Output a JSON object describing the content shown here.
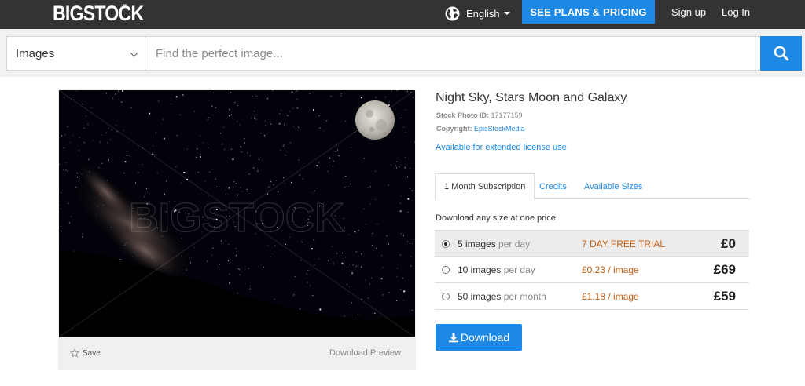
{
  "header": {
    "logo": "BIGSTOCK",
    "logo_tm": "™",
    "language": "English",
    "plans_button": "SEE PLANS & PRICING",
    "signup": "Sign up",
    "login": "Log In"
  },
  "search": {
    "category": "Images",
    "placeholder": "Find the perfect image..."
  },
  "image": {
    "watermark": "BIGSTOCK",
    "save_label": "Save",
    "preview_label": "Download Preview"
  },
  "details": {
    "title": "Night Sky, Stars Moon and Galaxy",
    "stock_id_label": "Stock Photo ID:",
    "stock_id": "17177159",
    "copyright_label": "Copyright:",
    "copyright": "EpicStockMedia",
    "extended_license": "Available for extended license use"
  },
  "tabs": [
    {
      "label": "1 Month Subscription",
      "active": true
    },
    {
      "label": "Credits",
      "active": false
    },
    {
      "label": "Available Sizes",
      "active": false
    }
  ],
  "pricing": {
    "intro": "Download any size at one price",
    "plans": [
      {
        "count": "5 images",
        "period": "per day",
        "offer": "7 DAY FREE TRIAL",
        "price": "£0",
        "selected": true
      },
      {
        "count": "10 images",
        "period": "per day",
        "offer": "£0.23 / image",
        "price": "£69",
        "selected": false
      },
      {
        "count": "50 images",
        "period": "per month",
        "offer": "£1.18 / image",
        "price": "£59",
        "selected": false
      }
    ]
  },
  "download_button": "Download",
  "colors": {
    "brand_blue": "#1e88e5",
    "topbar": "#333333",
    "offer_orange": "#c26016"
  }
}
